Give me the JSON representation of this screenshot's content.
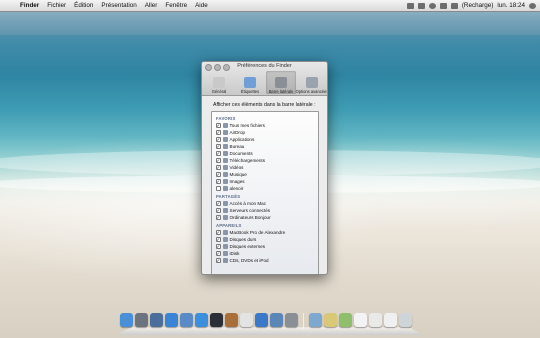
{
  "menubar": {
    "app_name": "Finder",
    "menus": [
      "Fichier",
      "Édition",
      "Présentation",
      "Aller",
      "Fenêtre",
      "Aide"
    ],
    "battery_status": "(Recharge)",
    "clock": "lun. 18:24"
  },
  "window": {
    "title": "Préférences du Finder",
    "toolbar": [
      {
        "label": "Général",
        "icon": "switch-icon",
        "color": "#c9c9c9"
      },
      {
        "label": "Étiquettes",
        "icon": "tag-icon",
        "color": "#6f9fd6"
      },
      {
        "label": "Barre latérale",
        "icon": "sidebar-icon",
        "color": "#8a8f96",
        "selected": true
      },
      {
        "label": "Options avancées",
        "icon": "gear-icon",
        "color": "#9aa3ad"
      }
    ],
    "prompt": "Afficher ces éléments dans la barre latérale :",
    "sections": [
      {
        "header": "FAVORIS",
        "items": [
          {
            "label": "Tous mes fichiers",
            "checked": true
          },
          {
            "label": "AirDrop",
            "checked": true
          },
          {
            "label": "Applications",
            "checked": true
          },
          {
            "label": "Bureau",
            "checked": true
          },
          {
            "label": "Documents",
            "checked": true
          },
          {
            "label": "Téléchargements",
            "checked": true
          },
          {
            "label": "Vidéos",
            "checked": true
          },
          {
            "label": "Musique",
            "checked": true
          },
          {
            "label": "Images",
            "checked": true
          },
          {
            "label": "alenoir",
            "checked": false
          }
        ]
      },
      {
        "header": "PARTAGÉS",
        "items": [
          {
            "label": "Accès à mon Mac",
            "checked": true
          },
          {
            "label": "Serveurs connectés",
            "checked": true
          },
          {
            "label": "Ordinateurs Bonjour",
            "checked": true
          }
        ]
      },
      {
        "header": "APPAREILS",
        "items": [
          {
            "label": "MacBook Pro de Alexandre",
            "checked": true
          },
          {
            "label": "Disques durs",
            "checked": true
          },
          {
            "label": "Disques externes",
            "checked": true
          },
          {
            "label": "iDisk",
            "checked": true
          },
          {
            "label": "CDs, DVDs et iPod",
            "checked": true
          }
        ]
      }
    ]
  },
  "dock": {
    "apps": [
      {
        "icon": "finder-icon",
        "color": "#4a90d9"
      },
      {
        "icon": "launchpad-icon",
        "color": "#6d7480"
      },
      {
        "icon": "mission-control-icon",
        "color": "#4b6e9c"
      },
      {
        "icon": "app-store-icon",
        "color": "#3a84d6"
      },
      {
        "icon": "mail-icon",
        "color": "#5a8bc7"
      },
      {
        "icon": "safari-icon",
        "color": "#3c8fdc"
      },
      {
        "icon": "dashboard-icon",
        "color": "#2b2f38"
      },
      {
        "icon": "address-book-icon",
        "color": "#a86f3b"
      },
      {
        "icon": "calendar-icon",
        "color": "#e3e3e3"
      },
      {
        "icon": "itunes-icon",
        "color": "#3a78c9"
      },
      {
        "icon": "preview-icon",
        "color": "#5a86b8"
      },
      {
        "icon": "system-preferences-icon",
        "color": "#8a8f96"
      }
    ],
    "stacks": [
      {
        "icon": "applications-folder-icon",
        "color": "#7fa8cf"
      },
      {
        "icon": "documents-folder-icon",
        "color": "#d9c77a"
      },
      {
        "icon": "downloads-folder-icon",
        "color": "#8fbf6a"
      },
      {
        "icon": "document-icon",
        "color": "#f3f3f3"
      },
      {
        "icon": "spreadsheet-icon",
        "color": "#e9e9e9"
      },
      {
        "icon": "notes-icon",
        "color": "#f0f0f0"
      },
      {
        "icon": "trash-icon",
        "color": "#cfd4d8"
      }
    ]
  }
}
